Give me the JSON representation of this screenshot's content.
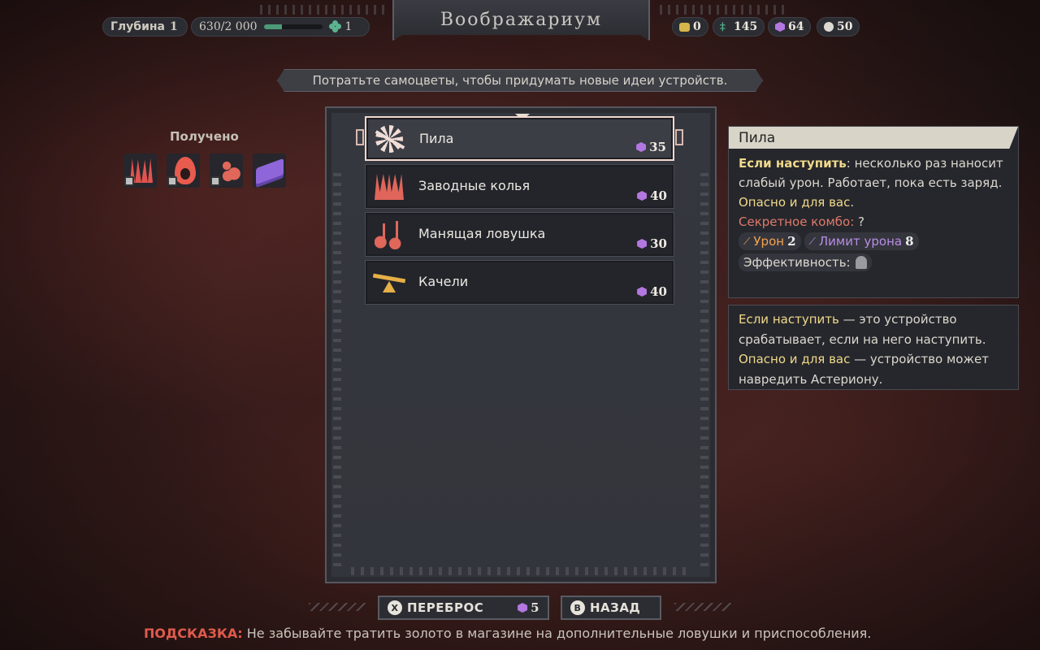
{
  "header": {
    "depth_label": "Глубина",
    "depth_value": "1",
    "progress_text": "630/2 000",
    "progress_fraction": 0.315,
    "progress_level": "1",
    "title": "Воображариум"
  },
  "resources": [
    {
      "icon": "gold-coin-icon",
      "value": "0",
      "color": "#d7b54a"
    },
    {
      "icon": "herb-icon",
      "value": "145",
      "color": "#58b88f"
    },
    {
      "icon": "gem-icon",
      "value": "64",
      "color": "#b377e0"
    },
    {
      "icon": "orb-icon",
      "value": "50",
      "color": "#dcd9d3"
    }
  ],
  "subtitle": "Потратьте самоцветы, чтобы придумать новые идеи устройств.",
  "obtained": {
    "label": "Получено",
    "items": [
      "spikes-trap-icon",
      "fire-trap-icon",
      "lure-figure-icon",
      "spellbook-icon"
    ]
  },
  "items": [
    {
      "name": "Пила",
      "cost": "35",
      "icon": "saw-icon",
      "selected": true
    },
    {
      "name": "Заводные колья",
      "cost": "40",
      "icon": "clockwork-spikes-icon",
      "selected": false
    },
    {
      "name": "Манящая ловушка",
      "cost": "30",
      "icon": "music-notes-icon",
      "selected": false
    },
    {
      "name": "Качели",
      "cost": "40",
      "icon": "seesaw-icon",
      "selected": false
    }
  ],
  "details": {
    "title": "Пила",
    "trigger_label": "Если наступить",
    "trigger_text": ": несколько раз наносит слабый урон. Работает, пока есть заряд.",
    "danger_text": "Опасно и для вас",
    "danger_suffix": ".",
    "combo_label": "Секретное комбо:",
    "combo_value": "?",
    "damage_label": "Урон",
    "damage_value": "2",
    "limit_label": "Лимит урона",
    "limit_value": "8",
    "efficiency_label": "Эффективность:"
  },
  "glossary": {
    "term1": "Если наступить",
    "text1": " — это устройство срабатывает, если на него наступить.",
    "term2": "Опасно и для вас",
    "text2": " — устройство может навредить Астериону."
  },
  "buttons": {
    "reroll_glyph": "X",
    "reroll_label": "ПЕРЕБРОС",
    "reroll_cost": "5",
    "back_glyph": "B",
    "back_label": "НАЗАД"
  },
  "hint": {
    "label": "ПОДСКАЗКА:",
    "text": " Не забывайте тратить золото в магазине на дополнительные ловушки и приспособления."
  }
}
